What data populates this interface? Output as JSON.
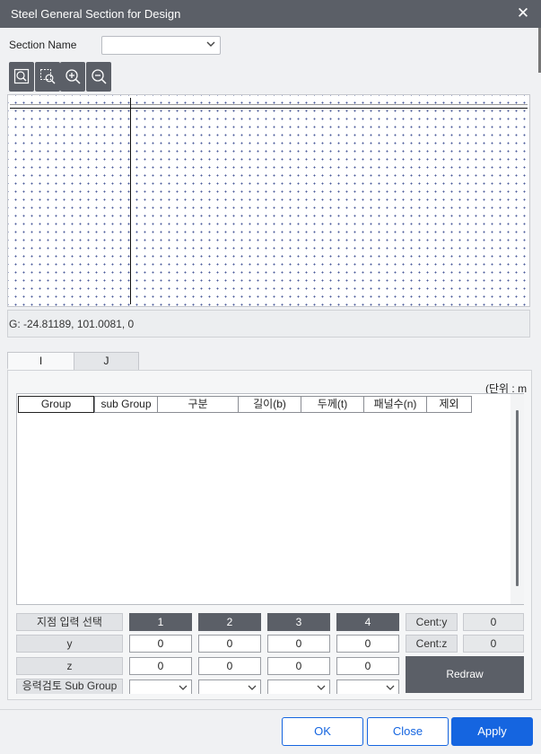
{
  "window": {
    "title": "Steel General Section for Design",
    "close_glyph": "✕"
  },
  "section": {
    "label": "Section Name",
    "value": ""
  },
  "toolbar": {
    "icons": [
      "zoom-fit-icon",
      "zoom-window-icon",
      "zoom-in-icon",
      "zoom-out-icon"
    ]
  },
  "coords": {
    "text": "G: -24.81189, 101.0081, 0"
  },
  "tabs": [
    {
      "label": "I"
    },
    {
      "label": "J"
    }
  ],
  "unit": {
    "text": "(단위 : m"
  },
  "table": {
    "columns": [
      "Group",
      "sub Group",
      "구분",
      "길이(b)",
      "두께(t)",
      "패널수(n)",
      "제외"
    ],
    "rows": []
  },
  "points": {
    "select_label": "지점 입력 선택",
    "y_label": "y",
    "z_label": "z",
    "subgroup_label": "응력검토 Sub Group",
    "numbers": [
      "1",
      "2",
      "3",
      "4"
    ],
    "y_values": [
      "0",
      "0",
      "0",
      "0"
    ],
    "z_values": [
      "0",
      "0",
      "0",
      "0"
    ],
    "subgroup_values": [
      "",
      "",
      "",
      ""
    ]
  },
  "centroid": {
    "y_label": "Cent:y",
    "y_value": "0",
    "z_label": "Cent:z",
    "z_value": "0"
  },
  "redraw_label": "Redraw",
  "footer": {
    "ok": "OK",
    "close": "Close",
    "apply": "Apply"
  },
  "colors": {
    "titlebar": "#5b5f67",
    "accent": "#1565e0",
    "dark_button": "#5b5f67"
  }
}
